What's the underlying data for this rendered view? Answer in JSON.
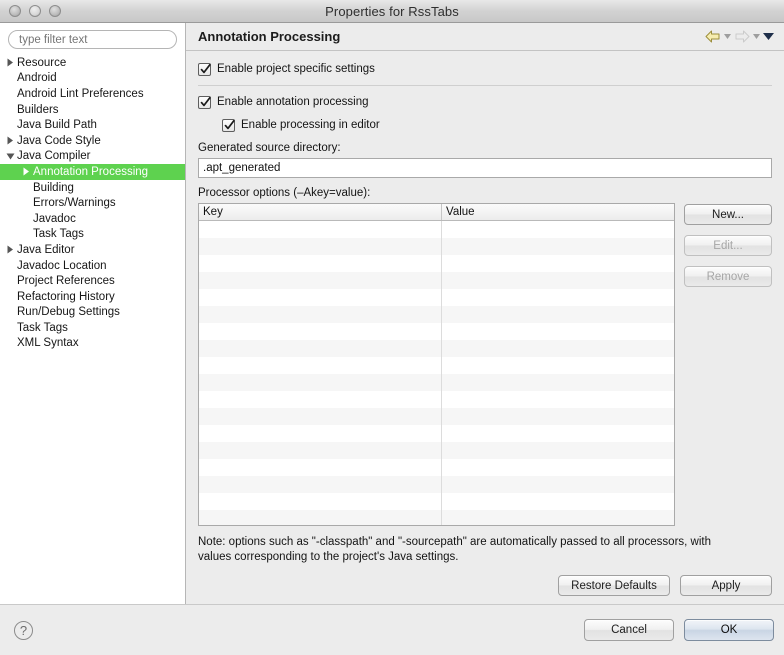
{
  "window": {
    "title": "Properties for RssTabs",
    "controls": [
      "close-button",
      "minimize-button",
      "zoom-button"
    ]
  },
  "sidebar": {
    "filter": {
      "placeholder": "type filter text",
      "value": ""
    },
    "items": [
      {
        "label": "Resource",
        "indent": 1,
        "twisty": "collapsed",
        "selected": false
      },
      {
        "label": "Android",
        "indent": 1,
        "twisty": "none",
        "selected": false
      },
      {
        "label": "Android Lint Preferences",
        "indent": 1,
        "twisty": "none",
        "selected": false
      },
      {
        "label": "Builders",
        "indent": 1,
        "twisty": "none",
        "selected": false
      },
      {
        "label": "Java Build Path",
        "indent": 1,
        "twisty": "none",
        "selected": false
      },
      {
        "label": "Java Code Style",
        "indent": 1,
        "twisty": "collapsed",
        "selected": false
      },
      {
        "label": "Java Compiler",
        "indent": 1,
        "twisty": "expanded",
        "selected": false
      },
      {
        "label": "Annotation Processing",
        "indent": 2,
        "twisty": "collapsed",
        "selected": true
      },
      {
        "label": "Building",
        "indent": 2,
        "twisty": "none",
        "selected": false
      },
      {
        "label": "Errors/Warnings",
        "indent": 2,
        "twisty": "none",
        "selected": false
      },
      {
        "label": "Javadoc",
        "indent": 2,
        "twisty": "none",
        "selected": false
      },
      {
        "label": "Task Tags",
        "indent": 2,
        "twisty": "none",
        "selected": false
      },
      {
        "label": "Java Editor",
        "indent": 1,
        "twisty": "collapsed",
        "selected": false
      },
      {
        "label": "Javadoc Location",
        "indent": 1,
        "twisty": "none",
        "selected": false
      },
      {
        "label": "Project References",
        "indent": 1,
        "twisty": "none",
        "selected": false
      },
      {
        "label": "Refactoring History",
        "indent": 1,
        "twisty": "none",
        "selected": false
      },
      {
        "label": "Run/Debug Settings",
        "indent": 1,
        "twisty": "none",
        "selected": false
      },
      {
        "label": "Task Tags",
        "indent": 1,
        "twisty": "none",
        "selected": false
      },
      {
        "label": "XML Syntax",
        "indent": 1,
        "twisty": "none",
        "selected": false
      }
    ]
  },
  "main": {
    "title": "Annotation Processing",
    "nav": {
      "back_icon": "back-arrow-icon",
      "back_menu_icon": "back-dropdown-icon",
      "forward_icon": "forward-arrow-icon",
      "forward_menu_icon": "forward-dropdown-icon",
      "menu_icon": "view-menu-icon"
    },
    "checkboxes": [
      {
        "label": "Enable project specific settings",
        "checked": true,
        "sub": false
      },
      {
        "label": "Enable annotation processing",
        "checked": true,
        "sub": false
      },
      {
        "label": "Enable processing in editor",
        "checked": true,
        "sub": true
      }
    ],
    "generated_source": {
      "label": "Generated source directory:",
      "value": ".apt_generated"
    },
    "processor_options": {
      "label": "Processor options (–Akey=value):",
      "columns": [
        "Key",
        "Value"
      ],
      "rows": []
    },
    "side_buttons": [
      {
        "label": "New...",
        "enabled": true
      },
      {
        "label": "Edit...",
        "enabled": false
      },
      {
        "label": "Remove",
        "enabled": false
      }
    ],
    "note": "Note: options such as \"-classpath\" and \"-sourcepath\" are automatically passed to all processors, with values corresponding to the project's Java settings.",
    "bottom_buttons": [
      {
        "label": "Restore Defaults",
        "enabled": true
      },
      {
        "label": "Apply",
        "enabled": true
      }
    ]
  },
  "footer": {
    "help_icon": "help-question-icon",
    "buttons": [
      {
        "label": "Cancel",
        "default": false
      },
      {
        "label": "OK",
        "default": true
      }
    ]
  },
  "colors": {
    "selection_green": "#5ed24f",
    "back_arrow_yellow": "#f4e7a0",
    "default_button_blue": "#c9d5e4"
  }
}
